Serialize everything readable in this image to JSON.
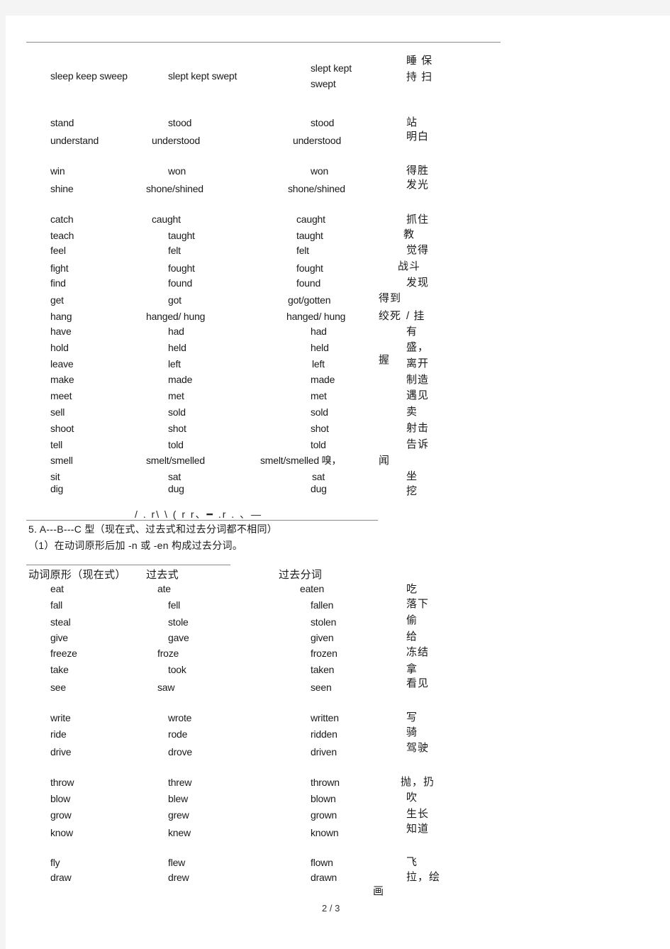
{
  "page_indicator": "2 / 3",
  "section1": {
    "rows": [
      {
        "base": "sleep  keep  sweep",
        "past": "slept  kept  swept",
        "pp_line1": "slept  kept",
        "pp_line2": "swept",
        "cn_line1": "睡 保",
        "cn_line2": "持 扫"
      },
      {
        "base": "stand",
        "past": "stood",
        "pp": "stood",
        "cn": "站"
      },
      {
        "base": "understand",
        "past": "understood",
        "pp": "understood",
        "cn": "明白"
      },
      {
        "base": "win",
        "past": "won",
        "pp": "won",
        "cn": "得胜"
      },
      {
        "base": "shine",
        "past": "shone/shined",
        "pp": "shone/shined",
        "cn": "发光"
      },
      {
        "base": "catch",
        "past": "caught",
        "pp": "caught",
        "cn": "抓住"
      },
      {
        "base": "teach",
        "past": "taught",
        "pp": "taught",
        "cn": "教"
      },
      {
        "base": "feel",
        "past": "felt",
        "pp": "felt",
        "cn": "觉得"
      },
      {
        "base": "fight",
        "past": "fought",
        "pp": "fought",
        "cn": "战斗"
      },
      {
        "base": "find",
        "past": "found",
        "pp": "found",
        "cn": "发现"
      },
      {
        "base": "get",
        "past": "got",
        "pp": "got/gotten",
        "cn": "得到"
      },
      {
        "base": "hang",
        "past": "hanged/  hung",
        "pp": "hanged/  hung",
        "cn_a": "绞死",
        "cn_b": "/ 挂"
      },
      {
        "base": "have",
        "past": "had",
        "pp": "had",
        "cn": "有"
      },
      {
        "base": "hold",
        "past": "held",
        "pp": "held",
        "cn_a": "盛，",
        "cn_b": "握"
      },
      {
        "base": "leave",
        "past": "left",
        "pp": "left",
        "cn": "离开"
      },
      {
        "base": "make",
        "past": "made",
        "pp": "made",
        "cn": "制造"
      },
      {
        "base": "meet",
        "past": "met",
        "pp": "met",
        "cn": "遇见"
      },
      {
        "base": "sell",
        "past": "sold",
        "pp": "sold",
        "cn": "卖"
      },
      {
        "base": "shoot",
        "past": "shot",
        "pp": "shot",
        "cn": "射击"
      },
      {
        "base": "tell",
        "past": "told",
        "pp": "told",
        "cn": "告诉"
      },
      {
        "base": "smell",
        "past": "smelt/smelled",
        "pp": "smelt/smelled  嗅，",
        "cn": "闻"
      },
      {
        "base": "sit",
        "past": "sat",
        "pp": "sat",
        "cn": "坐"
      },
      {
        "base": "dig",
        "past": "dug",
        "pp": "dug",
        "cn": "挖"
      }
    ]
  },
  "garbled_line": "/ . r\\   \\ ( r  r、━ .r . 、—",
  "section5": {
    "heading": "5. A---B---C      型（现在式、过去式和过去分词都不相同）",
    "subheading": "（1）在动词原形后加  -n  或  -en  构成过去分词。",
    "col_headers": {
      "base": "动词原形（现在式）",
      "past": "过去式",
      "pp": "过去分词"
    },
    "rows": [
      {
        "base": "eat",
        "past": "ate",
        "pp": "eaten",
        "cn": "吃"
      },
      {
        "base": "fall",
        "past": "fell",
        "pp": "fallen",
        "cn": "落下"
      },
      {
        "base": "steal",
        "past": "stole",
        "pp": "stolen",
        "cn": "偷"
      },
      {
        "base": "give",
        "past": "gave",
        "pp": "given",
        "cn": "给"
      },
      {
        "base": "freeze",
        "past": "froze",
        "pp": "frozen",
        "cn": "冻结"
      },
      {
        "base": "take",
        "past": "took",
        "pp": "taken",
        "cn": "拿"
      },
      {
        "base": "see",
        "past": "saw",
        "pp": "seen",
        "cn": "看见"
      },
      {
        "base": "write",
        "past": "wrote",
        "pp": "written",
        "cn": "写"
      },
      {
        "base": "ride",
        "past": "rode",
        "pp": "ridden",
        "cn": "骑"
      },
      {
        "base": "drive",
        "past": "drove",
        "pp": "driven",
        "cn": "驾驶"
      },
      {
        "base": "throw",
        "past": "threw",
        "pp": "thrown",
        "cn": "抛，扔"
      },
      {
        "base": "blow",
        "past": "blew",
        "pp": "blown",
        "cn": "吹"
      },
      {
        "base": "grow",
        "past": "grew",
        "pp": "grown",
        "cn": "生长"
      },
      {
        "base": "know",
        "past": "knew",
        "pp": "known",
        "cn": "知道"
      },
      {
        "base": "fly",
        "past": "flew",
        "pp": "flown",
        "cn": "飞"
      },
      {
        "base": "draw",
        "past": "drew",
        "pp": "drawn",
        "cn_a": "拉，绘",
        "cn_b": "画"
      }
    ]
  }
}
